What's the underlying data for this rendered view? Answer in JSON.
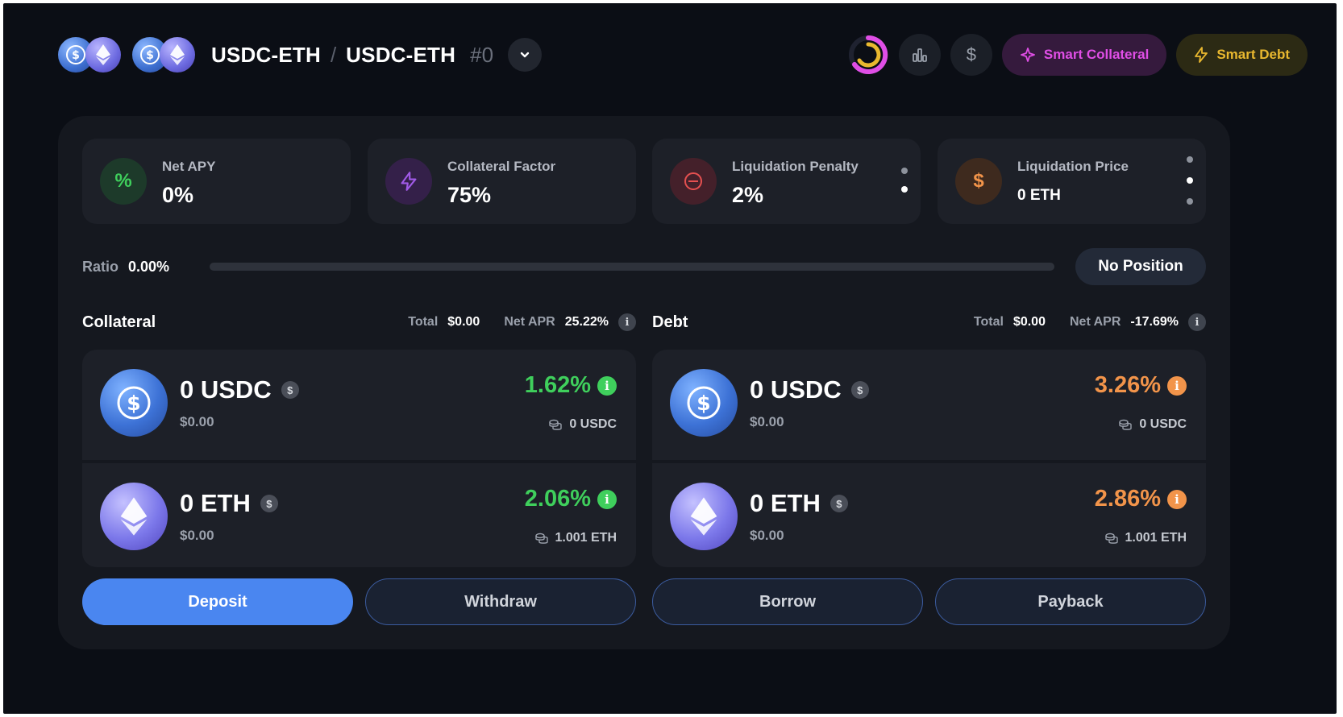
{
  "header": {
    "pair_left": "USDC-ETH",
    "separator": "/",
    "pair_right": "USDC-ETH",
    "position_id": "#0",
    "smart_collateral_label": "Smart Collateral",
    "smart_debt_label": "Smart Debt",
    "dollar_btn": "$"
  },
  "stats": [
    {
      "label": "Net APY",
      "value": "0%",
      "icon": "%",
      "color": "#3fcf5c"
    },
    {
      "label": "Collateral Factor",
      "value": "75%",
      "icon": "lightning-icon",
      "color": "#a05ae6"
    },
    {
      "label": "Liquidation Penalty",
      "value": "2%",
      "icon": "minus-circle-icon",
      "color": "#e55050"
    },
    {
      "label": "Liquidation Price",
      "value": "0 ETH",
      "icon": "$",
      "color": "#f2944a"
    }
  ],
  "ratio": {
    "label": "Ratio",
    "value": "0.00%",
    "status": "No Position"
  },
  "collateral": {
    "title": "Collateral",
    "total_label": "Total",
    "total_value": "$0.00",
    "apr_label": "Net APR",
    "apr_value": "25.22%",
    "rows": [
      {
        "amount": "0 USDC",
        "usd": "$0.00",
        "apr": "1.62%",
        "liquidity": "0 USDC"
      },
      {
        "amount": "0 ETH",
        "usd": "$0.00",
        "apr": "2.06%",
        "liquidity": "1.001 ETH"
      }
    ]
  },
  "debt": {
    "title": "Debt",
    "total_label": "Total",
    "total_value": "$0.00",
    "apr_label": "Net APR",
    "apr_value": "-17.69%",
    "rows": [
      {
        "amount": "0 USDC",
        "usd": "$0.00",
        "apr": "3.26%",
        "liquidity": "0 USDC"
      },
      {
        "amount": "0 ETH",
        "usd": "$0.00",
        "apr": "2.86%",
        "liquidity": "1.001 ETH"
      }
    ]
  },
  "actions": {
    "deposit": "Deposit",
    "withdraw": "Withdraw",
    "borrow": "Borrow",
    "payback": "Payback"
  },
  "colors": {
    "accent": "#4a86f0",
    "positive": "#3fcf5c",
    "negative": "#f2944a",
    "smart_collateral": "#e04ee6",
    "smart_debt": "#e9b82f"
  }
}
